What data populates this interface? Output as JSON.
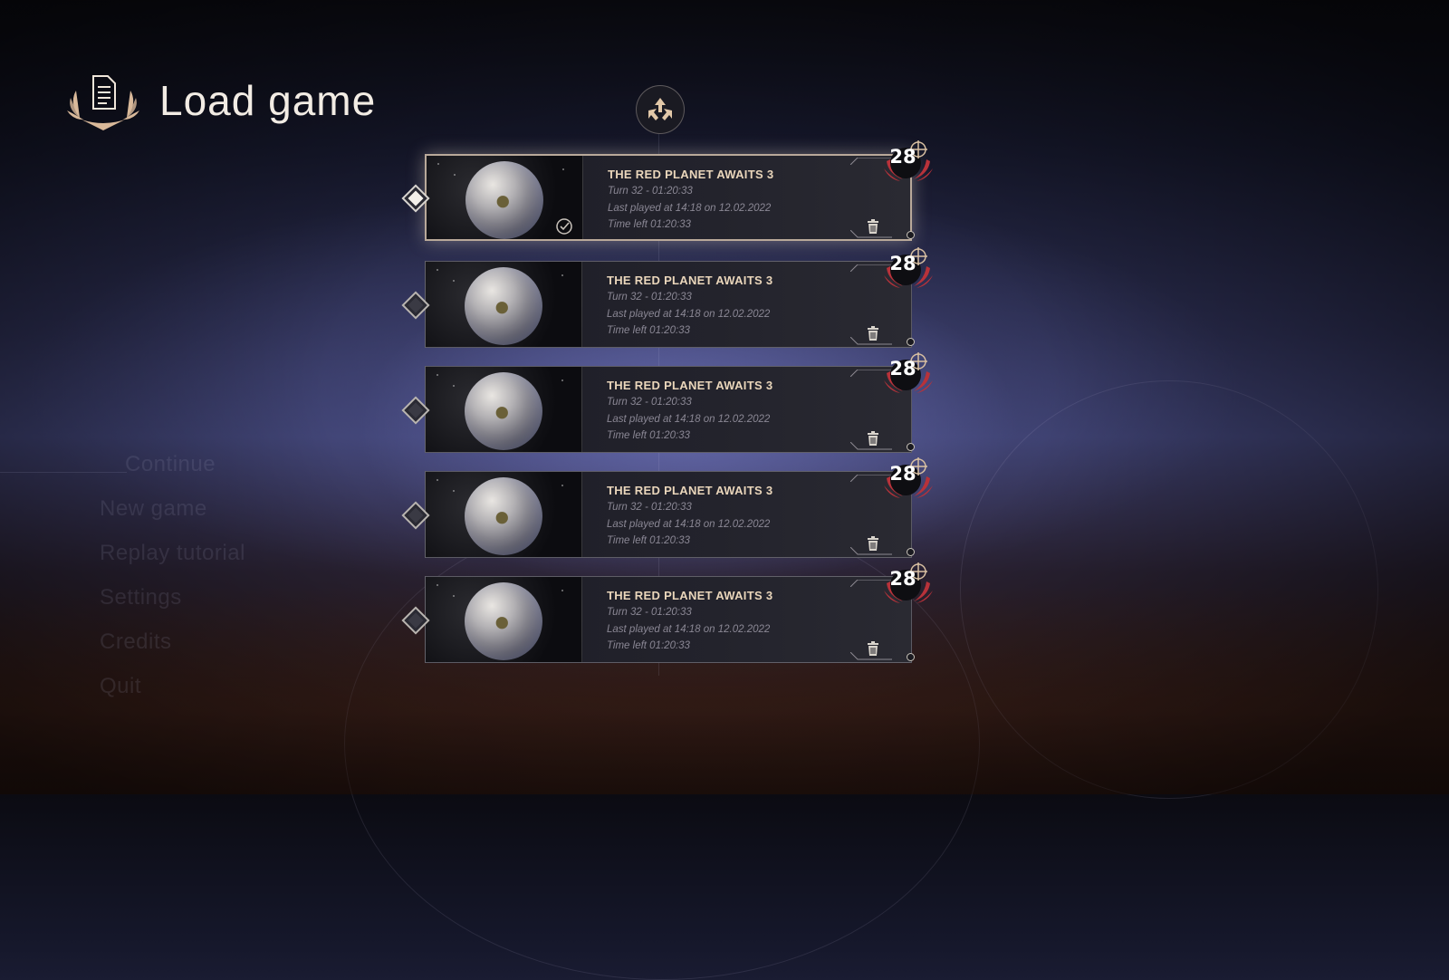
{
  "header": {
    "title": "Load game",
    "icon": "laurel-document-icon"
  },
  "menu": [
    "Continue",
    "New game",
    "Replay tutorial",
    "Settings",
    "Credits",
    "Quit"
  ],
  "accent": "#ead6bb",
  "saves": [
    {
      "title": "THE RED PLANET AWAITS 3",
      "turn": "Turn 32 - 01:20:33",
      "last_played": "Last played at 14:18 on 12.02.2022",
      "time_left": "Time left  01:20:33",
      "rank": "28",
      "selected": true
    },
    {
      "title": "THE RED PLANET AWAITS 3",
      "turn": "Turn 32 - 01:20:33",
      "last_played": "Last played at 14:18 on 12.02.2022",
      "time_left": "Time left  01:20:33",
      "rank": "28",
      "selected": false
    },
    {
      "title": "THE RED PLANET AWAITS 3",
      "turn": "Turn 32 - 01:20:33",
      "last_played": "Last played at 14:18 on 12.02.2022",
      "time_left": "Time left  01:20:33",
      "rank": "28",
      "selected": false
    },
    {
      "title": "THE RED PLANET AWAITS 3",
      "turn": "Turn 32 - 01:20:33",
      "last_played": "Last played at 14:18 on 12.02.2022",
      "time_left": "Time left  01:20:33",
      "rank": "28",
      "selected": false
    },
    {
      "title": "THE RED PLANET AWAITS 3",
      "turn": "Turn 32 - 01:20:33",
      "last_played": "Last played at 14:18 on 12.02.2022",
      "time_left": "Time left  01:20:33",
      "rank": "28",
      "selected": false
    }
  ]
}
